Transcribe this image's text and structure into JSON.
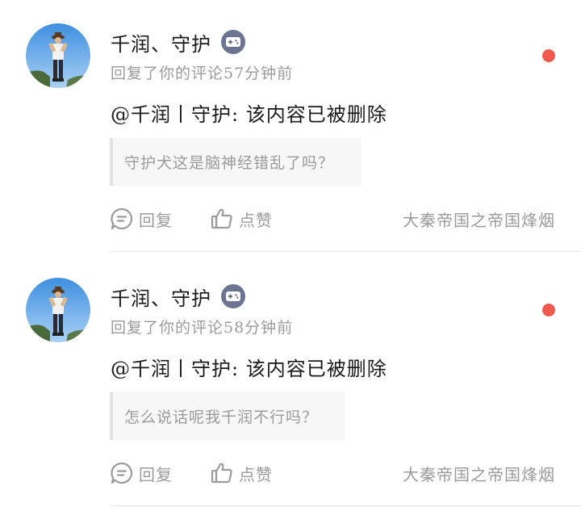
{
  "notifications": [
    {
      "user_name": "千润、守护",
      "badge_icon": "gamepad-icon",
      "time_text": "回复了你的评论57分钟前",
      "content": "@千润丨守护: 该内容已被删除",
      "quoted": "守护犬这是脑神经错乱了吗？",
      "reply_label": "回复",
      "like_label": "点赞",
      "source": "大秦帝国之帝国烽烟",
      "unread": true
    },
    {
      "user_name": "千润、守护",
      "badge_icon": "gamepad-icon",
      "time_text": "回复了你的评论58分钟前",
      "content": "@千润丨守护: 该内容已被删除",
      "quoted": "怎么说话呢我千润不行吗？",
      "reply_label": "回复",
      "like_label": "点赞",
      "source": "大秦帝国之帝国烽烟",
      "unread": true
    }
  ],
  "colors": {
    "unread_dot": "#f25a4e",
    "badge": "#6b7592",
    "muted_text": "#9b9b9b",
    "primary_text": "#1a1a1a"
  }
}
